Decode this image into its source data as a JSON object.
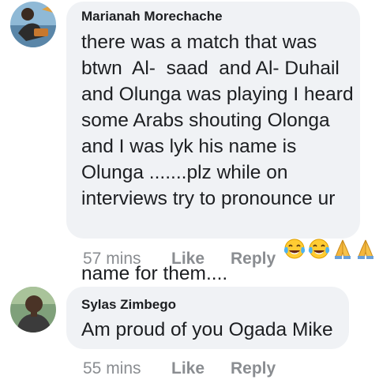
{
  "comments": [
    {
      "author": "Marianah Morechache",
      "lines": [
        "there was a match that was",
        "btwn  Al-  saad  and Al- Duhail",
        "and Olunga was playing I heard",
        "some Arabs shouting Olonga",
        "and I was lyk his name is",
        "Olunga .......plz while on",
        "interviews try to pronounce ur",
        "name for them...."
      ],
      "emojis": [
        "face-with-tears-of-joy-icon",
        "face-with-tears-of-joy-icon",
        "folded-hands-icon",
        "folded-hands-icon"
      ],
      "time": "57 mins",
      "like_label": "Like",
      "reply_label": "Reply"
    },
    {
      "author": "Sylas Zimbego",
      "lines": [
        "Am proud of you Ogada Mike"
      ],
      "time": "55 mins",
      "like_label": "Like",
      "reply_label": "Reply"
    }
  ],
  "colors": {
    "bubble": "#f0f2f5",
    "text": "#1c1e21",
    "meta": "#8a8d91"
  }
}
